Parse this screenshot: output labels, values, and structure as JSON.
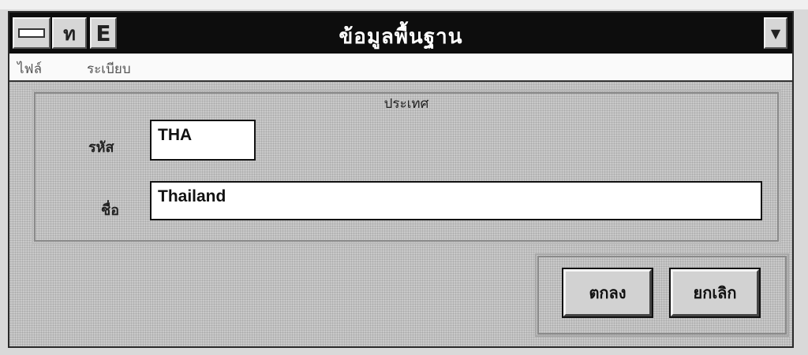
{
  "window": {
    "title": "ข้อมูลพื้นฐาน",
    "app_icon_glyph": "ท",
    "e_icon_glyph": "E",
    "dropdown_glyph": "▼"
  },
  "menu": {
    "items": [
      {
        "label": "ไฟล์"
      },
      {
        "label": "ระเบียบ"
      }
    ]
  },
  "group": {
    "title": "ประเทศ",
    "code_label": "รหัส",
    "code_value": "THA",
    "name_label": "ชื่อ",
    "name_value": "Thailand"
  },
  "buttons": {
    "ok_label": "ตกลง",
    "cancel_label": "ยกเลิก"
  }
}
